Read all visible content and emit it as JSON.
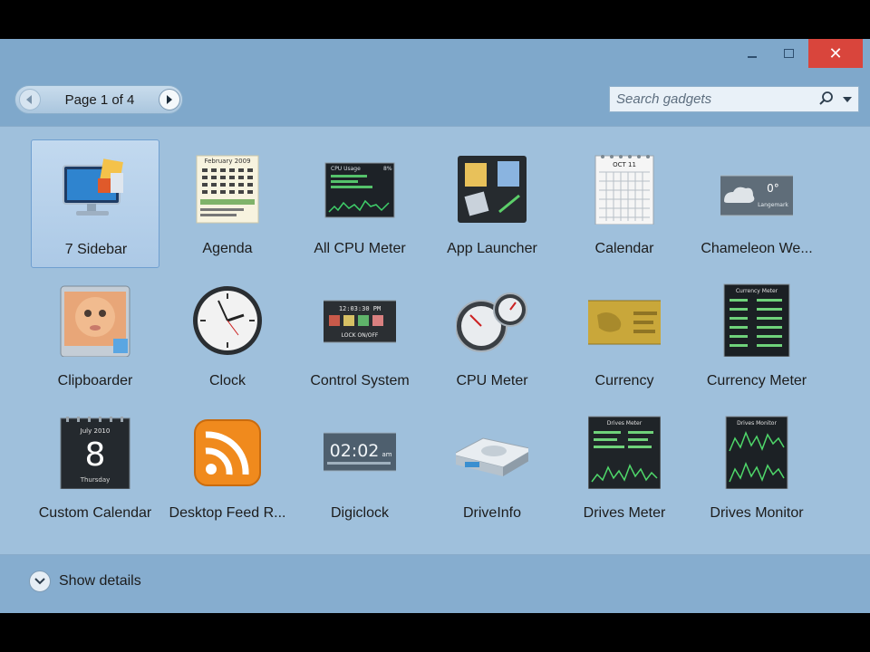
{
  "window": {
    "close_glyph": "✕"
  },
  "pager": {
    "label": "Page 1 of 4",
    "prev_icon": "chevron-left-icon",
    "next_icon": "chevron-right-icon"
  },
  "search": {
    "placeholder": "Search gadgets",
    "value": ""
  },
  "gadgets": [
    {
      "label": "7 Sidebar",
      "icon": "monitor-icon",
      "selected": true
    },
    {
      "label": "Agenda",
      "icon": "agenda-icon",
      "selected": false
    },
    {
      "label": "All CPU Meter",
      "icon": "cpu-graph-icon",
      "selected": false
    },
    {
      "label": "App Launcher",
      "icon": "app-launcher-icon",
      "selected": false
    },
    {
      "label": "Calendar",
      "icon": "calendar-icon",
      "selected": false
    },
    {
      "label": "Chameleon We...",
      "icon": "weather-icon",
      "selected": false
    },
    {
      "label": "Clipboarder",
      "icon": "clipboard-photo-icon",
      "selected": false
    },
    {
      "label": "Clock",
      "icon": "clock-icon",
      "selected": false
    },
    {
      "label": "Control System",
      "icon": "control-panel-icon",
      "selected": false
    },
    {
      "label": "CPU Meter",
      "icon": "gauge-icon",
      "selected": false
    },
    {
      "label": "Currency",
      "icon": "currency-card-icon",
      "selected": false
    },
    {
      "label": "Currency Meter",
      "icon": "currency-list-icon",
      "selected": false
    },
    {
      "label": "Custom Calendar",
      "icon": "day-calendar-icon",
      "selected": false
    },
    {
      "label": "Desktop Feed R...",
      "icon": "rss-icon",
      "selected": false
    },
    {
      "label": "Digiclock",
      "icon": "digital-clock-icon",
      "selected": false
    },
    {
      "label": "DriveInfo",
      "icon": "hard-drive-icon",
      "selected": false
    },
    {
      "label": "Drives Meter",
      "icon": "drive-meter-icon",
      "selected": false
    },
    {
      "label": "Drives Monitor",
      "icon": "drive-monitor-icon",
      "selected": false
    }
  ],
  "thumb_text": {
    "agenda_month": "February 2009",
    "cpu_title": "CPU Usage",
    "cpu_pct": "8%",
    "calendar_month": "OCT 11",
    "weather_temp": "0°",
    "weather_city": "Langemark",
    "control_time": "12:03:30 PM",
    "control_brand": "LOCK ON/OFF",
    "currency_meter_title": "Currency Meter",
    "custom_cal_month": "July 2010",
    "custom_cal_day": "8",
    "custom_cal_weekday": "Thursday",
    "digiclock_time": "02:02",
    "digiclock_ampm": "am",
    "drives_meter_title": "Drives Meter",
    "drives_monitor_title": "Drives Monitor"
  },
  "footer": {
    "details_label": "Show details"
  },
  "colors": {
    "window_bg": "#7fa8cb",
    "grid_bg": "#9fc0dc",
    "close_red": "#d9453c",
    "rss_orange": "#f08a1d"
  }
}
